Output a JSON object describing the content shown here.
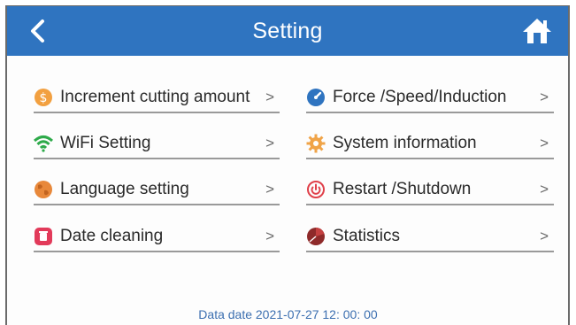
{
  "header": {
    "title": "Setting",
    "accent": "#2f74c0",
    "back_icon": "chevron-left-icon",
    "home_icon": "home-icon"
  },
  "menu": {
    "left": [
      {
        "label": "Increment cutting amount",
        "icon": "dollar-coin-icon",
        "chevron": ">"
      },
      {
        "label": "WiFi Setting",
        "icon": "wifi-icon",
        "chevron": ">"
      },
      {
        "label": "Language setting",
        "icon": "globe-icon",
        "chevron": ">"
      },
      {
        "label": "Date cleaning",
        "icon": "trash-icon",
        "chevron": ">"
      }
    ],
    "right": [
      {
        "label": "Force /Speed/Induction",
        "icon": "gauge-icon",
        "chevron": ">"
      },
      {
        "label": "System information",
        "icon": "gear-icon",
        "chevron": ">"
      },
      {
        "label": "Restart /Shutdown",
        "icon": "power-icon",
        "chevron": ">"
      },
      {
        "label": "Statistics",
        "icon": "pie-chart-icon",
        "chevron": ">"
      }
    ]
  },
  "footer": {
    "data_date": "Data date 2021-07-27 12:  00:  00"
  }
}
